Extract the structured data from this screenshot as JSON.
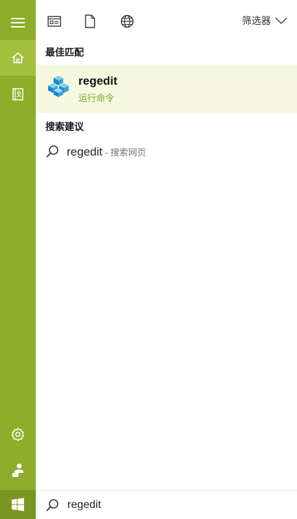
{
  "rail": {
    "items": [
      {
        "name": "hamburger-menu-icon"
      },
      {
        "name": "home-icon"
      },
      {
        "name": "notebook-icon"
      },
      {
        "name": "settings-icon"
      },
      {
        "name": "feedback-icon"
      },
      {
        "name": "windows-logo-icon"
      }
    ],
    "accent": "#8fad2a"
  },
  "header": {
    "icons": [
      "apps-icon",
      "documents-icon",
      "web-globe-icon"
    ],
    "filter_label": "筛选器"
  },
  "best_match": {
    "heading": "最佳匹配",
    "title": "regedit",
    "subtitle": "运行命令",
    "icon": "regedit-cubes-icon"
  },
  "suggestions": {
    "heading": "搜索建议",
    "items": [
      {
        "query": "regedit",
        "suffix": " - 搜索网页"
      }
    ]
  },
  "search": {
    "value": "regedit",
    "icon": "search-icon"
  }
}
